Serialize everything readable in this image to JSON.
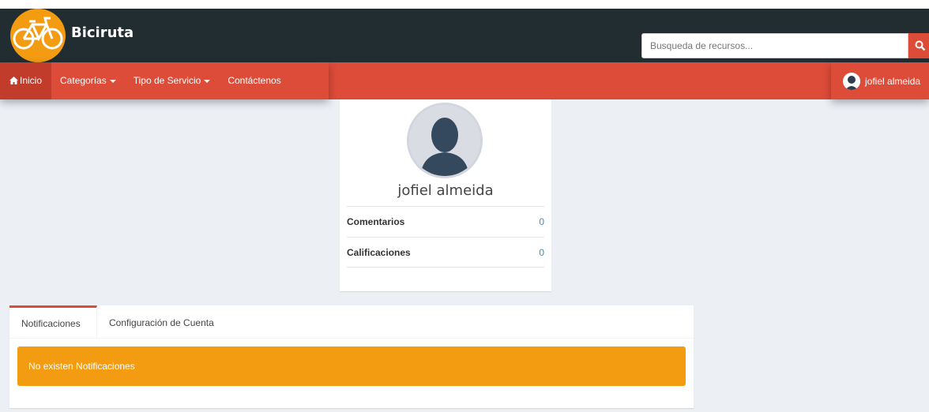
{
  "header": {
    "brand": "Biciruta",
    "search_placeholder": "Busqueda de recursos...",
    "brand_color": "#f39c12",
    "bar_color": "#222d32"
  },
  "nav": {
    "items": [
      {
        "label": "Inicio",
        "icon": "home-icon",
        "active": true
      },
      {
        "label": "Categorías",
        "dropdown": true
      },
      {
        "label": "Tipo de Servicio",
        "dropdown": true
      },
      {
        "label": "Contáctenos"
      }
    ],
    "user": "jofiel almeida",
    "color": "#dd4b39"
  },
  "profile": {
    "name": "jofiel almeida",
    "stats": [
      {
        "label": "Comentarios",
        "value": "0"
      },
      {
        "label": "Calificaciones",
        "value": "0"
      }
    ]
  },
  "tabs": {
    "items": [
      {
        "label": "Notificaciones",
        "active": true
      },
      {
        "label": "Configuración de Cuenta"
      }
    ],
    "alert": "No existen Notificaciones"
  }
}
